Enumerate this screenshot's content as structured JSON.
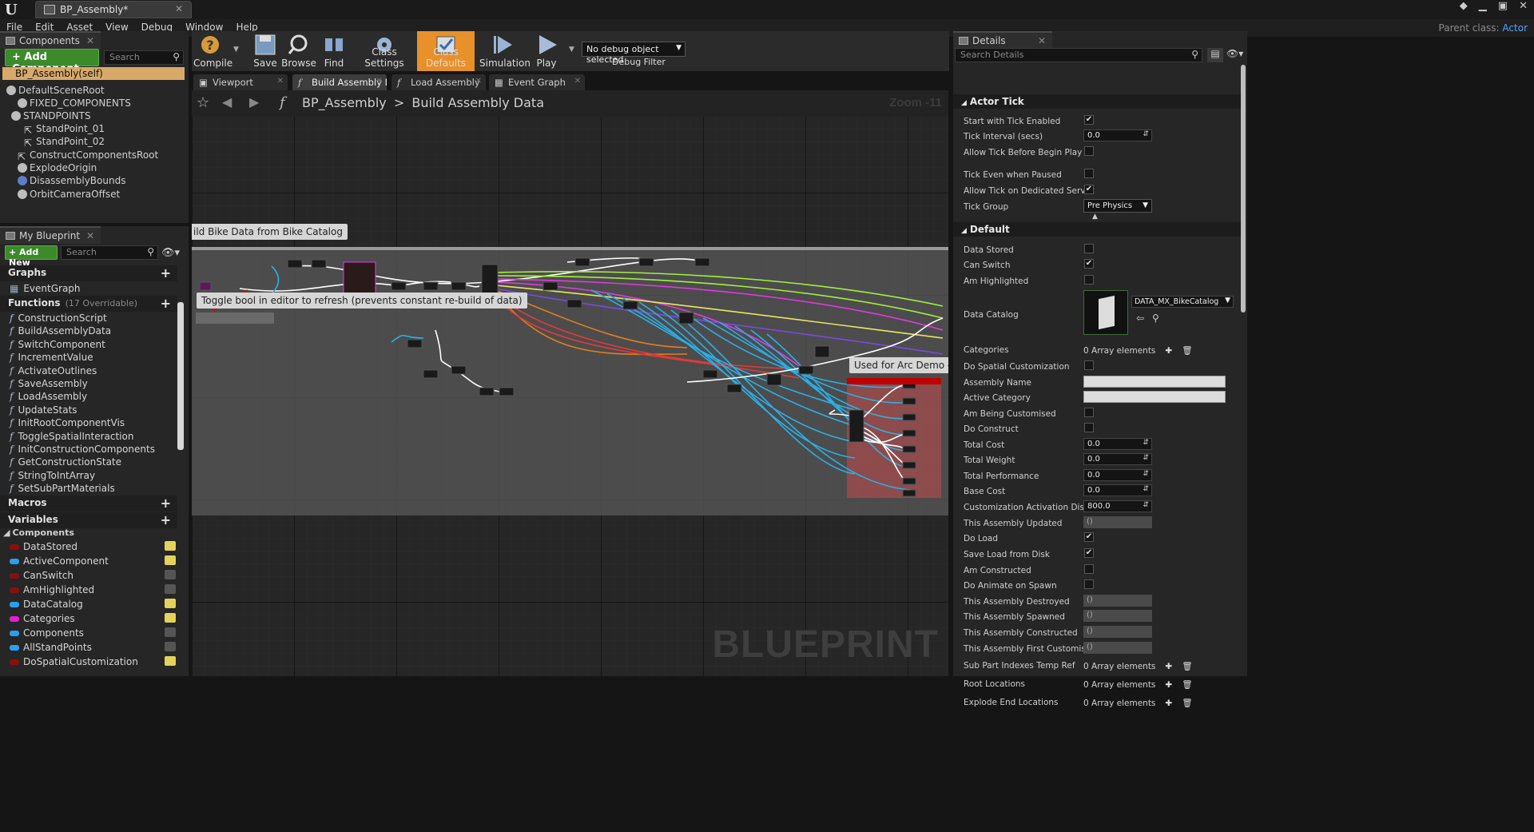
{
  "window": {
    "tab_title": "BP_Assembly*",
    "parent_class_label": "Parent class:",
    "parent_class_value": "Actor"
  },
  "menu": [
    "File",
    "Edit",
    "Asset",
    "View",
    "Debug",
    "Window",
    "Help"
  ],
  "components_panel": {
    "tab": "Components",
    "add_button": "+ Add Component",
    "search_placeholder": "Search",
    "self_item": "BP_Assembly(self)",
    "tree": [
      "DefaultSceneRoot",
      "FIXED_COMPONENTS",
      "STANDPOINTS",
      "StandPoint_01",
      "StandPoint_02",
      "ConstructComponentsRoot",
      "ExplodeOrigin",
      "DisassemblyBounds",
      "OrbitCameraOffset"
    ]
  },
  "my_blueprint": {
    "tab": "My Blueprint",
    "add_new": "+ Add New",
    "search_placeholder": "Search",
    "graphs_header": "Graphs",
    "event_graph": "EventGraph",
    "functions_header": "Functions",
    "functions_count": "(17 Overridable)",
    "functions": [
      "ConstructionScript",
      "BuildAssemblyData",
      "SwitchComponent",
      "IncrementValue",
      "ActivateOutlines",
      "SaveAssembly",
      "LoadAssembly",
      "UpdateStats",
      "InitRootComponentVis",
      "ToggleSpatialInteraction",
      "InitConstructionComponents",
      "GetConstructionState",
      "StringToIntArray",
      "SetSubPartMaterials"
    ],
    "macros_header": "Macros",
    "variables_header": "Variables",
    "components_sub": "Components",
    "variables": [
      {
        "name": "DataStored",
        "color": "#8a0e0e",
        "eye": true
      },
      {
        "name": "ActiveComponent",
        "color": "#2a9ff0",
        "eye": true
      },
      {
        "name": "CanSwitch",
        "color": "#8a0e0e",
        "eye": false
      },
      {
        "name": "AmHighlighted",
        "color": "#8a0e0e",
        "eye": false
      },
      {
        "name": "DataCatalog",
        "color": "#2a9ff0",
        "eye": true
      },
      {
        "name": "Categories",
        "color": "#e020d0",
        "eye": true
      },
      {
        "name": "Components",
        "color": "#2a9ff0",
        "eye": false
      },
      {
        "name": "AllStandPoints",
        "color": "#2a9ff0",
        "eye": false
      },
      {
        "name": "DoSpatialCustomization",
        "color": "#8a0e0e",
        "eye": true
      }
    ]
  },
  "toolbar": {
    "compile": "Compile",
    "save": "Save",
    "browse": "Browse",
    "find": "Find",
    "class_settings": "Class Settings",
    "class_defaults": "Class Defaults",
    "simulation": "Simulation",
    "play": "Play",
    "debug_select": "No debug object selected",
    "debug_filter": "Debug Filter"
  },
  "graph_tabs": [
    "Viewport",
    "Build Assembly Da",
    "Load Assembly",
    "Event Graph"
  ],
  "graph": {
    "crumb_root": "BP_Assembly",
    "crumb_sep": ">",
    "crumb_leaf": "Build Assembly Data",
    "zoom": "Zoom -11",
    "comment_1": "ild Bike Data from Bike Catalog",
    "comment_2": "Toggle bool in editor to refresh (prevents constant re-build of data)",
    "comment_3": "Used for Arc Demo - may",
    "watermark": "BLUEPRINT"
  },
  "details": {
    "tab": "Details",
    "search_placeholder": "Search Details",
    "actor_tick_header": "Actor Tick",
    "default_header": "Default",
    "actor_tick": [
      {
        "label": "Start with Tick Enabled",
        "type": "check",
        "value": true
      },
      {
        "label": "Tick Interval (secs)",
        "type": "num",
        "value": "0.0"
      },
      {
        "label": "Allow Tick Before Begin Play",
        "type": "check",
        "value": false
      },
      {
        "label": "Tick Even when Paused",
        "type": "check",
        "value": false
      },
      {
        "label": "Allow Tick on Dedicated Server",
        "type": "check",
        "value": true
      },
      {
        "label": "Tick Group",
        "type": "select",
        "value": "Pre Physics"
      }
    ],
    "default": [
      {
        "label": "Data Stored",
        "type": "check",
        "value": false
      },
      {
        "label": "Can Switch",
        "type": "check",
        "value": true
      },
      {
        "label": "Am Highlighted",
        "type": "check",
        "value": false
      },
      {
        "label": "Data Catalog",
        "type": "asset",
        "value": "DATA_MX_BikeCatalog"
      },
      {
        "label": "Categories",
        "type": "array",
        "value": "0 Array elements"
      },
      {
        "label": "Do Spatial Customization",
        "type": "check",
        "value": false
      },
      {
        "label": "Assembly Name",
        "type": "text",
        "value": ""
      },
      {
        "label": "Active Category",
        "type": "text",
        "value": ""
      },
      {
        "label": "Am Being Customised",
        "type": "check",
        "value": false
      },
      {
        "label": "Do Construct",
        "type": "check",
        "value": false
      },
      {
        "label": "Total Cost",
        "type": "num",
        "value": "0.0"
      },
      {
        "label": "Total Weight",
        "type": "num",
        "value": "0.0"
      },
      {
        "label": "Total Performance",
        "type": "num",
        "value": "0.0"
      },
      {
        "label": "Base Cost",
        "type": "num",
        "value": "0.0"
      },
      {
        "label": "Customization Activation Distance",
        "type": "num",
        "value": "800.0"
      },
      {
        "label": "This Assembly Updated",
        "type": "evt",
        "value": "()"
      },
      {
        "label": "Do Load",
        "type": "check",
        "value": true
      },
      {
        "label": "Save Load from Disk",
        "type": "check",
        "value": true
      },
      {
        "label": "Am Constructed",
        "type": "check",
        "value": false
      },
      {
        "label": "Do Animate on Spawn",
        "type": "check",
        "value": false
      },
      {
        "label": "This Assembly Destroyed",
        "type": "evt",
        "value": "()"
      },
      {
        "label": "This Assembly Spawned",
        "type": "evt",
        "value": "()"
      },
      {
        "label": "This Assembly Constructed",
        "type": "evt",
        "value": "()"
      },
      {
        "label": "This Assembly First Customised",
        "type": "evt",
        "value": "()"
      },
      {
        "label": "Sub Part Indexes Temp Ref",
        "type": "array",
        "value": "0 Array elements"
      },
      {
        "label": "Root Locations",
        "type": "array",
        "value": "0 Array elements"
      },
      {
        "label": "Explode End Locations",
        "type": "array",
        "value": "0 Array elements"
      }
    ]
  }
}
